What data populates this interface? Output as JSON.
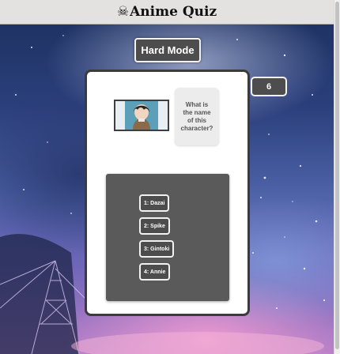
{
  "header": {
    "icon": "skull-crossbones-icon",
    "icon_glyph": "☠",
    "title": "Anime Quiz"
  },
  "mode_button": {
    "label": "Hard Mode"
  },
  "score": {
    "value": "6"
  },
  "question": {
    "text": "What is the name of this character?"
  },
  "answers": [
    {
      "label": "1: Dazai"
    },
    {
      "label": "2: Spike"
    },
    {
      "label": "3: Gintoki"
    },
    {
      "label": "4: Annie"
    }
  ],
  "colors": {
    "button_bg": "#4d4d4d",
    "button_border": "#f2f2f2",
    "panel_bg": "#5a5a5a",
    "card_bg": "#ffffff",
    "titlebar_bg": "#e4e2e0"
  }
}
